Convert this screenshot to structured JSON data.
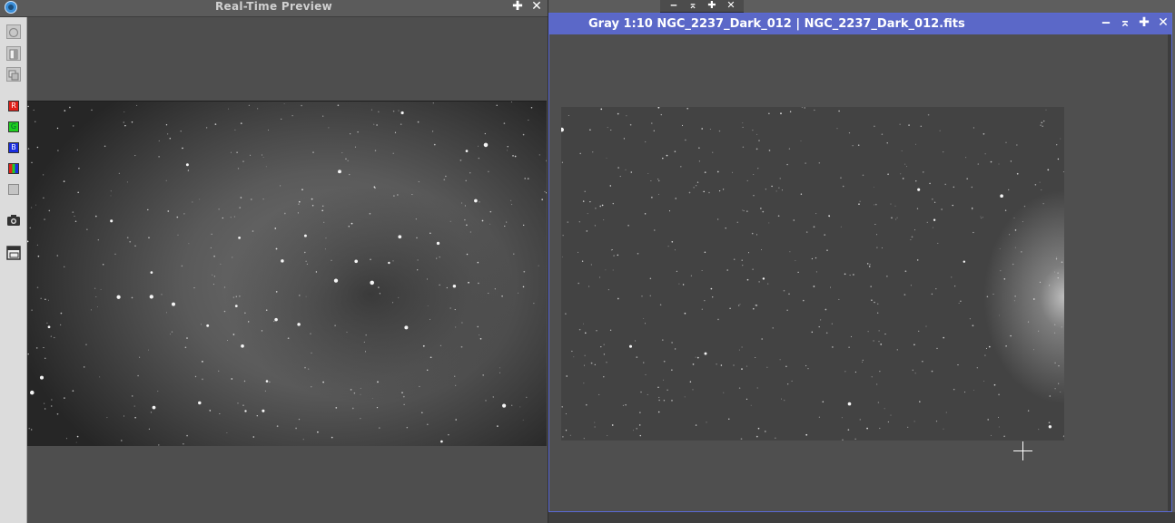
{
  "realtime_preview": {
    "title": "Real-Time Preview",
    "buttons": {
      "float": "✚",
      "close": "✕"
    },
    "toolbar": [
      {
        "name": "track-view-icon",
        "glyph": "○"
      },
      {
        "name": "show-original-icon",
        "glyph": ""
      },
      {
        "name": "show-mask-icon",
        "glyph": ""
      },
      {
        "name": "red-channel-icon",
        "label": "R",
        "color": "#e0201a"
      },
      {
        "name": "green-channel-icon",
        "label": "G",
        "color": "#1fce1f"
      },
      {
        "name": "blue-channel-icon",
        "label": "B",
        "color": "#1a2ee0"
      },
      {
        "name": "rgb-channel-icon",
        "label": "",
        "color": "#d0a020"
      },
      {
        "name": "luminance-channel-icon",
        "label": "",
        "color": "#c0c0c0"
      },
      {
        "name": "snapshot-icon",
        "glyph": ""
      },
      {
        "name": "new-window-icon",
        "glyph": ""
      }
    ]
  },
  "background_window": {
    "buttons": {
      "minimize": "‒",
      "shade": "⌅",
      "float": "✚",
      "close": "✕"
    }
  },
  "image_window": {
    "title": "Gray 1:10 NGC_2237_Dark_012 | NGC_2237_Dark_012.fits",
    "accent_color": "#5b68c8",
    "buttons": {
      "minimize": "‒",
      "shade": "⌅",
      "maximize": "✚",
      "close": "✕"
    }
  }
}
